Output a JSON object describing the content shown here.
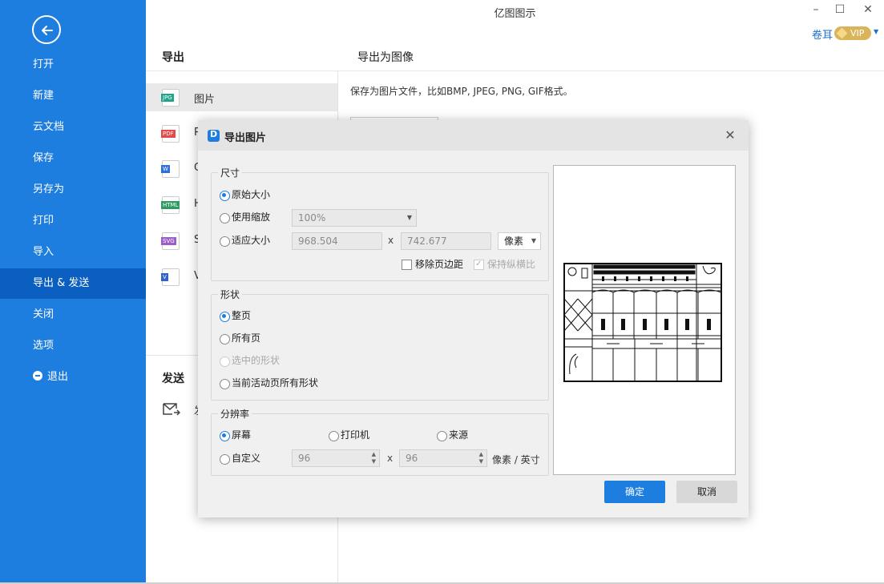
{
  "app": {
    "title": "亿图图示",
    "user_name": "卷耳",
    "vip_label": "VIP"
  },
  "sidebar": {
    "items": [
      {
        "label": "打开"
      },
      {
        "label": "新建"
      },
      {
        "label": "云文档"
      },
      {
        "label": "保存"
      },
      {
        "label": "另存为"
      },
      {
        "label": "打印"
      },
      {
        "label": "导入"
      },
      {
        "label": "导出 & 发送",
        "active": true
      },
      {
        "label": "关闭"
      },
      {
        "label": "选项"
      },
      {
        "label": "退出"
      }
    ]
  },
  "export_panel": {
    "heading": "导出",
    "formats": [
      {
        "badge": "JPG",
        "label": "图片",
        "color": "#21a38a"
      },
      {
        "badge": "PDF",
        "label": "P",
        "color": "#e34b4b"
      },
      {
        "badge": "W",
        "label": "O",
        "color": "#2f6fd6"
      },
      {
        "badge": "HTML",
        "label": "H",
        "color": "#2e9a61"
      },
      {
        "badge": "SVG",
        "label": "S",
        "color": "#9b5fc7"
      },
      {
        "badge": "V",
        "label": "V",
        "color": "#2f63c9"
      }
    ],
    "send_heading": "发送",
    "send_item_label": "发"
  },
  "right_panel": {
    "heading": "导出为图像",
    "description": "保存为图片文件，比如BMP, JPEG, PNG, GIF格式。"
  },
  "dialog": {
    "title": "导出图片",
    "size_group": {
      "legend": "尺寸",
      "opt_original": "原始大小",
      "opt_scale": "使用缩放",
      "scale_value": "100%",
      "opt_fit": "适应大小",
      "width": "968.504",
      "height": "742.677",
      "x_sep": "x",
      "unit": "像素",
      "remove_margin": "移除页边距",
      "keep_ratio": "保持纵横比"
    },
    "shape_group": {
      "legend": "形状",
      "opt_whole_page": "整页",
      "opt_all_pages": "所有页",
      "opt_selected": "选中的形状",
      "opt_active_page": "当前活动页所有形状"
    },
    "resolution_group": {
      "legend": "分辨率",
      "opt_screen": "屏幕",
      "opt_printer": "打印机",
      "opt_source": "来源",
      "opt_custom": "自定义",
      "dpi_x": "96",
      "dpi_y": "96",
      "x_sep": "x",
      "unit": "像素 / 英寸"
    },
    "ok_label": "确定",
    "cancel_label": "取消"
  }
}
